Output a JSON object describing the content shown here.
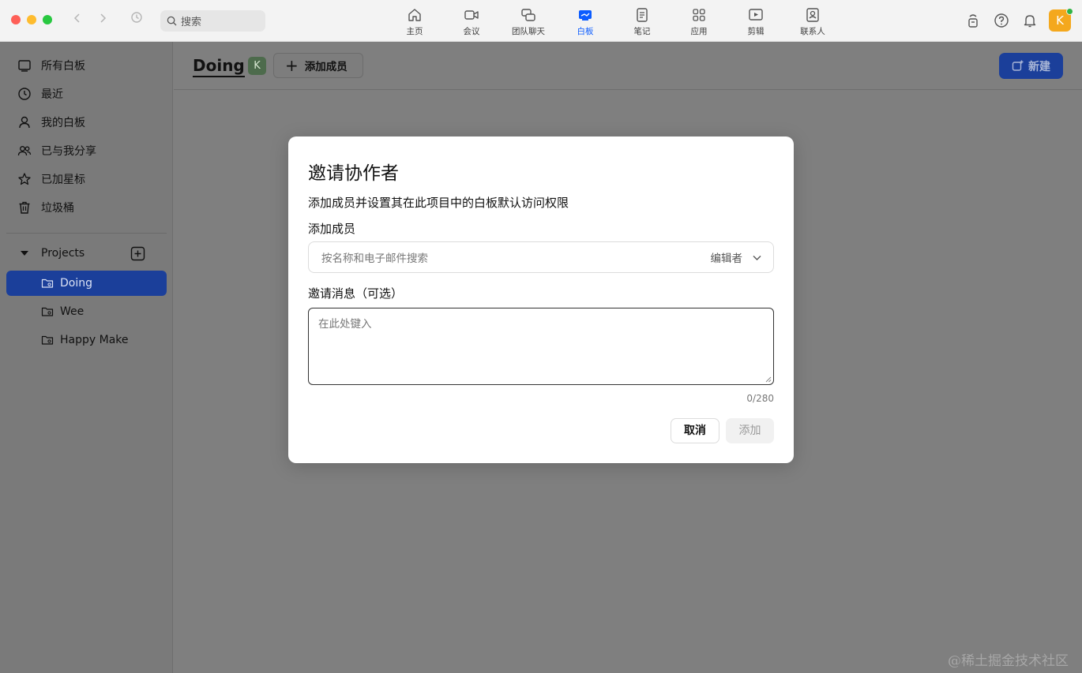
{
  "app": {
    "search_placeholder": "搜索",
    "nav_tabs": [
      {
        "label": "主页",
        "icon": "home-icon"
      },
      {
        "label": "会议",
        "icon": "video-icon"
      },
      {
        "label": "团队聊天",
        "icon": "chat-icon"
      },
      {
        "label": "白板",
        "icon": "whiteboard-icon",
        "active": true
      },
      {
        "label": "笔记",
        "icon": "notes-icon"
      },
      {
        "label": "应用",
        "icon": "apps-icon"
      },
      {
        "label": "剪辑",
        "icon": "clips-icon"
      },
      {
        "label": "联系人",
        "icon": "contacts-icon"
      }
    ],
    "avatar_initial": "K",
    "accent_color": "#0b5cff"
  },
  "sidebar": {
    "items": [
      {
        "label": "所有白板",
        "icon": "whiteboard-list-icon"
      },
      {
        "label": "最近",
        "icon": "clock-icon"
      },
      {
        "label": "我的白板",
        "icon": "person-icon"
      },
      {
        "label": "已与我分享",
        "icon": "people-icon"
      },
      {
        "label": "已加星标",
        "icon": "star-icon"
      },
      {
        "label": "垃圾桶",
        "icon": "trash-icon"
      }
    ],
    "projects_label": "Projects",
    "projects": [
      {
        "label": "Doing",
        "active": true
      },
      {
        "label": "Wee"
      },
      {
        "label": "Happy Make"
      }
    ]
  },
  "main": {
    "title": "Doing",
    "member_initial": "K",
    "add_member_label": "添加成员",
    "new_button_label": "新建"
  },
  "dialog": {
    "title": "邀请协作者",
    "description": "添加成员并设置其在此项目中的白板默认访问权限",
    "member_label": "添加成员",
    "member_placeholder": "按名称和电子邮件搜索",
    "role_value": "编辑者",
    "message_label": "邀请消息（可选）",
    "message_placeholder": "在此处键入",
    "char_counter": "0/280",
    "cancel_label": "取消",
    "add_label": "添加"
  },
  "watermark": "@稀土掘金技术社区"
}
